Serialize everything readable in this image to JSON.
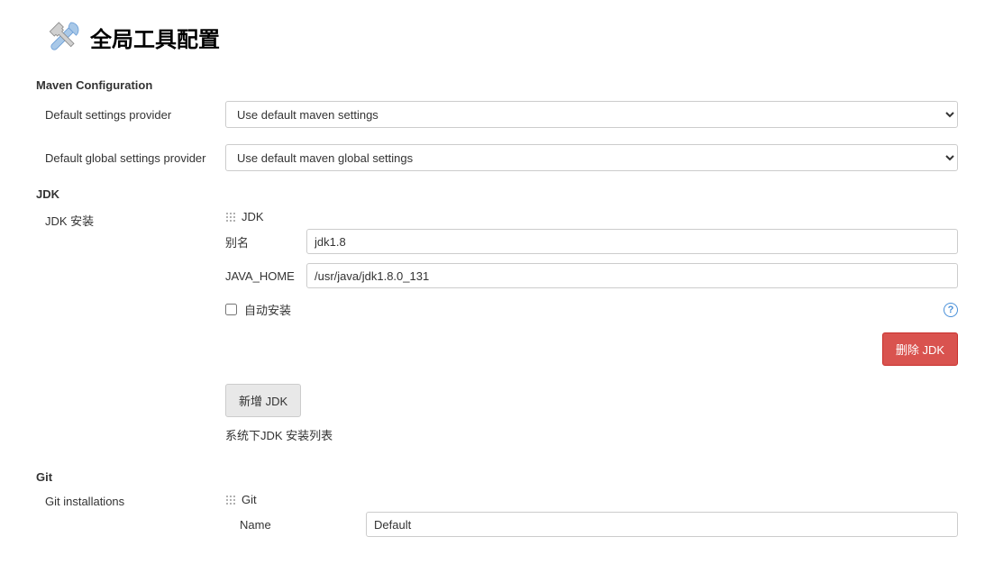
{
  "header": {
    "title": "全局工具配置"
  },
  "maven": {
    "heading": "Maven Configuration",
    "settings_label": "Default settings provider",
    "settings_value": "Use default maven settings",
    "global_label": "Default global settings provider",
    "global_value": "Use default maven global settings"
  },
  "jdk": {
    "heading": "JDK",
    "install_label": "JDK 安装",
    "tool_name": "JDK",
    "alias_label": "别名",
    "alias_value": "jdk1.8",
    "java_home_label": "JAVA_HOME",
    "java_home_value": "/usr/java/jdk1.8.0_131",
    "auto_install_label": "自动安装",
    "auto_install_checked": false,
    "delete_button": "删除 JDK",
    "add_button": "新增 JDK",
    "list_helper": "系统下JDK 安装列表"
  },
  "git": {
    "heading": "Git",
    "install_label": "Git installations",
    "tool_name": "Git",
    "name_label": "Name",
    "name_value": "Default"
  }
}
